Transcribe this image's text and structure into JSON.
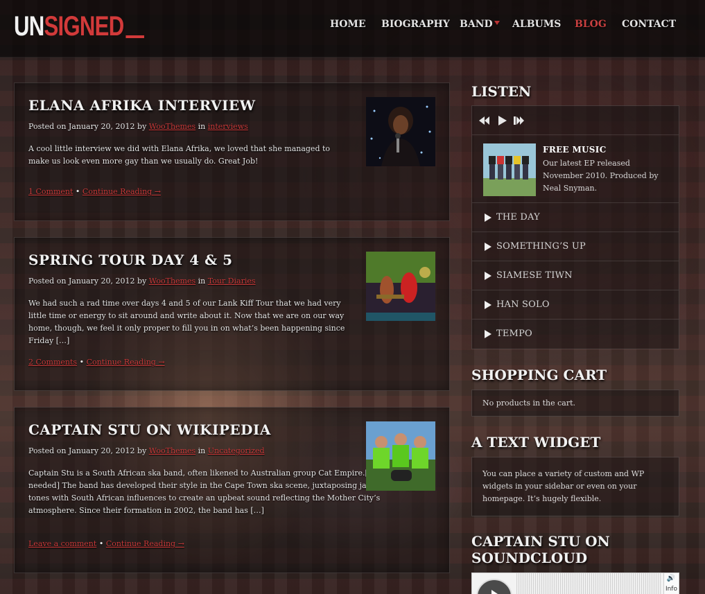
{
  "header": {
    "logo_un": "UN",
    "logo_signed": "SIGNED",
    "nav": [
      {
        "label": "HOME",
        "active": false
      },
      {
        "label": "BIOGRAPHY",
        "active": false
      },
      {
        "label": "BAND",
        "active": false,
        "has_submenu": true
      },
      {
        "label": "ALBUMS",
        "active": false
      },
      {
        "label": "BLOG",
        "active": true
      },
      {
        "label": "CONTACT",
        "active": false
      }
    ]
  },
  "posts": [
    {
      "title": "ELANA AFRIKA INTERVIEW",
      "posted_on": "Posted on January 20, 2012 by",
      "author": "WooThemes",
      "in": "in",
      "category": "interviews",
      "excerpt": "A cool little interview we did with Elana Afrika, we loved that she managed to make us look even more gay than we usually do. Great Job!",
      "comments": "1 Comment",
      "sep": "•",
      "continue": "Continue Reading →"
    },
    {
      "title": "SPRING TOUR DAY 4 & 5",
      "posted_on": "Posted on January 20, 2012 by",
      "author": "WooThemes",
      "in": "in",
      "category": "Tour Diaries",
      "excerpt": "We had such a rad time over days 4 and 5 of our Lank Kiff Tour that we had very little time or energy to sit around and write about it. Now that we are on our way home, though, we feel it only proper to fill you in on what’s been happening since Friday […]",
      "comments": "2 Comments",
      "sep": "•",
      "continue": "Continue Reading →"
    },
    {
      "title": "CAPTAIN STU ON WIKIPEDIA",
      "posted_on": "Posted on January 20, 2012 by",
      "author": "WooThemes",
      "in": "in",
      "category": "Uncategorized",
      "excerpt": "Captain Stu is a South African ska band, often likened to Australian group Cat Empire.[citation needed] The band has developed their style in the Cape Town ska scene, juxtaposing jazzy and reggae tones with South African influences to create an upbeat sound reflecting the Mother City’s atmosphere. Since their formation in 2002, the band has […]",
      "comments": "Leave a comment",
      "sep": "•",
      "continue": "Continue Reading →"
    }
  ],
  "sidebar": {
    "listen_title": "LISTEN",
    "album": {
      "title": "FREE MUSIC",
      "desc": "Our latest EP released November 2010. Produced by Neal Snyman."
    },
    "tracks": [
      "THE DAY",
      "SOMETHING’S UP",
      "SIAMESE TIWN",
      "HAN SOLO",
      "TEMPO"
    ],
    "cart_title": "SHOPPING CART",
    "cart_text": "No products in the cart.",
    "text_widget_title": "A TEXT WIDGET",
    "text_widget_body": "You can place a variety of custom and WP widgets in your sidebar or even on your homepage. It’s hugely flexible.",
    "soundcloud_title": "CAPTAIN STU ON SOUNDCLOUD",
    "soundcloud_info": "Info"
  },
  "colors": {
    "accent": "#c93a3a",
    "text": "#e4e4e4",
    "header_bg": "#0a0808"
  }
}
